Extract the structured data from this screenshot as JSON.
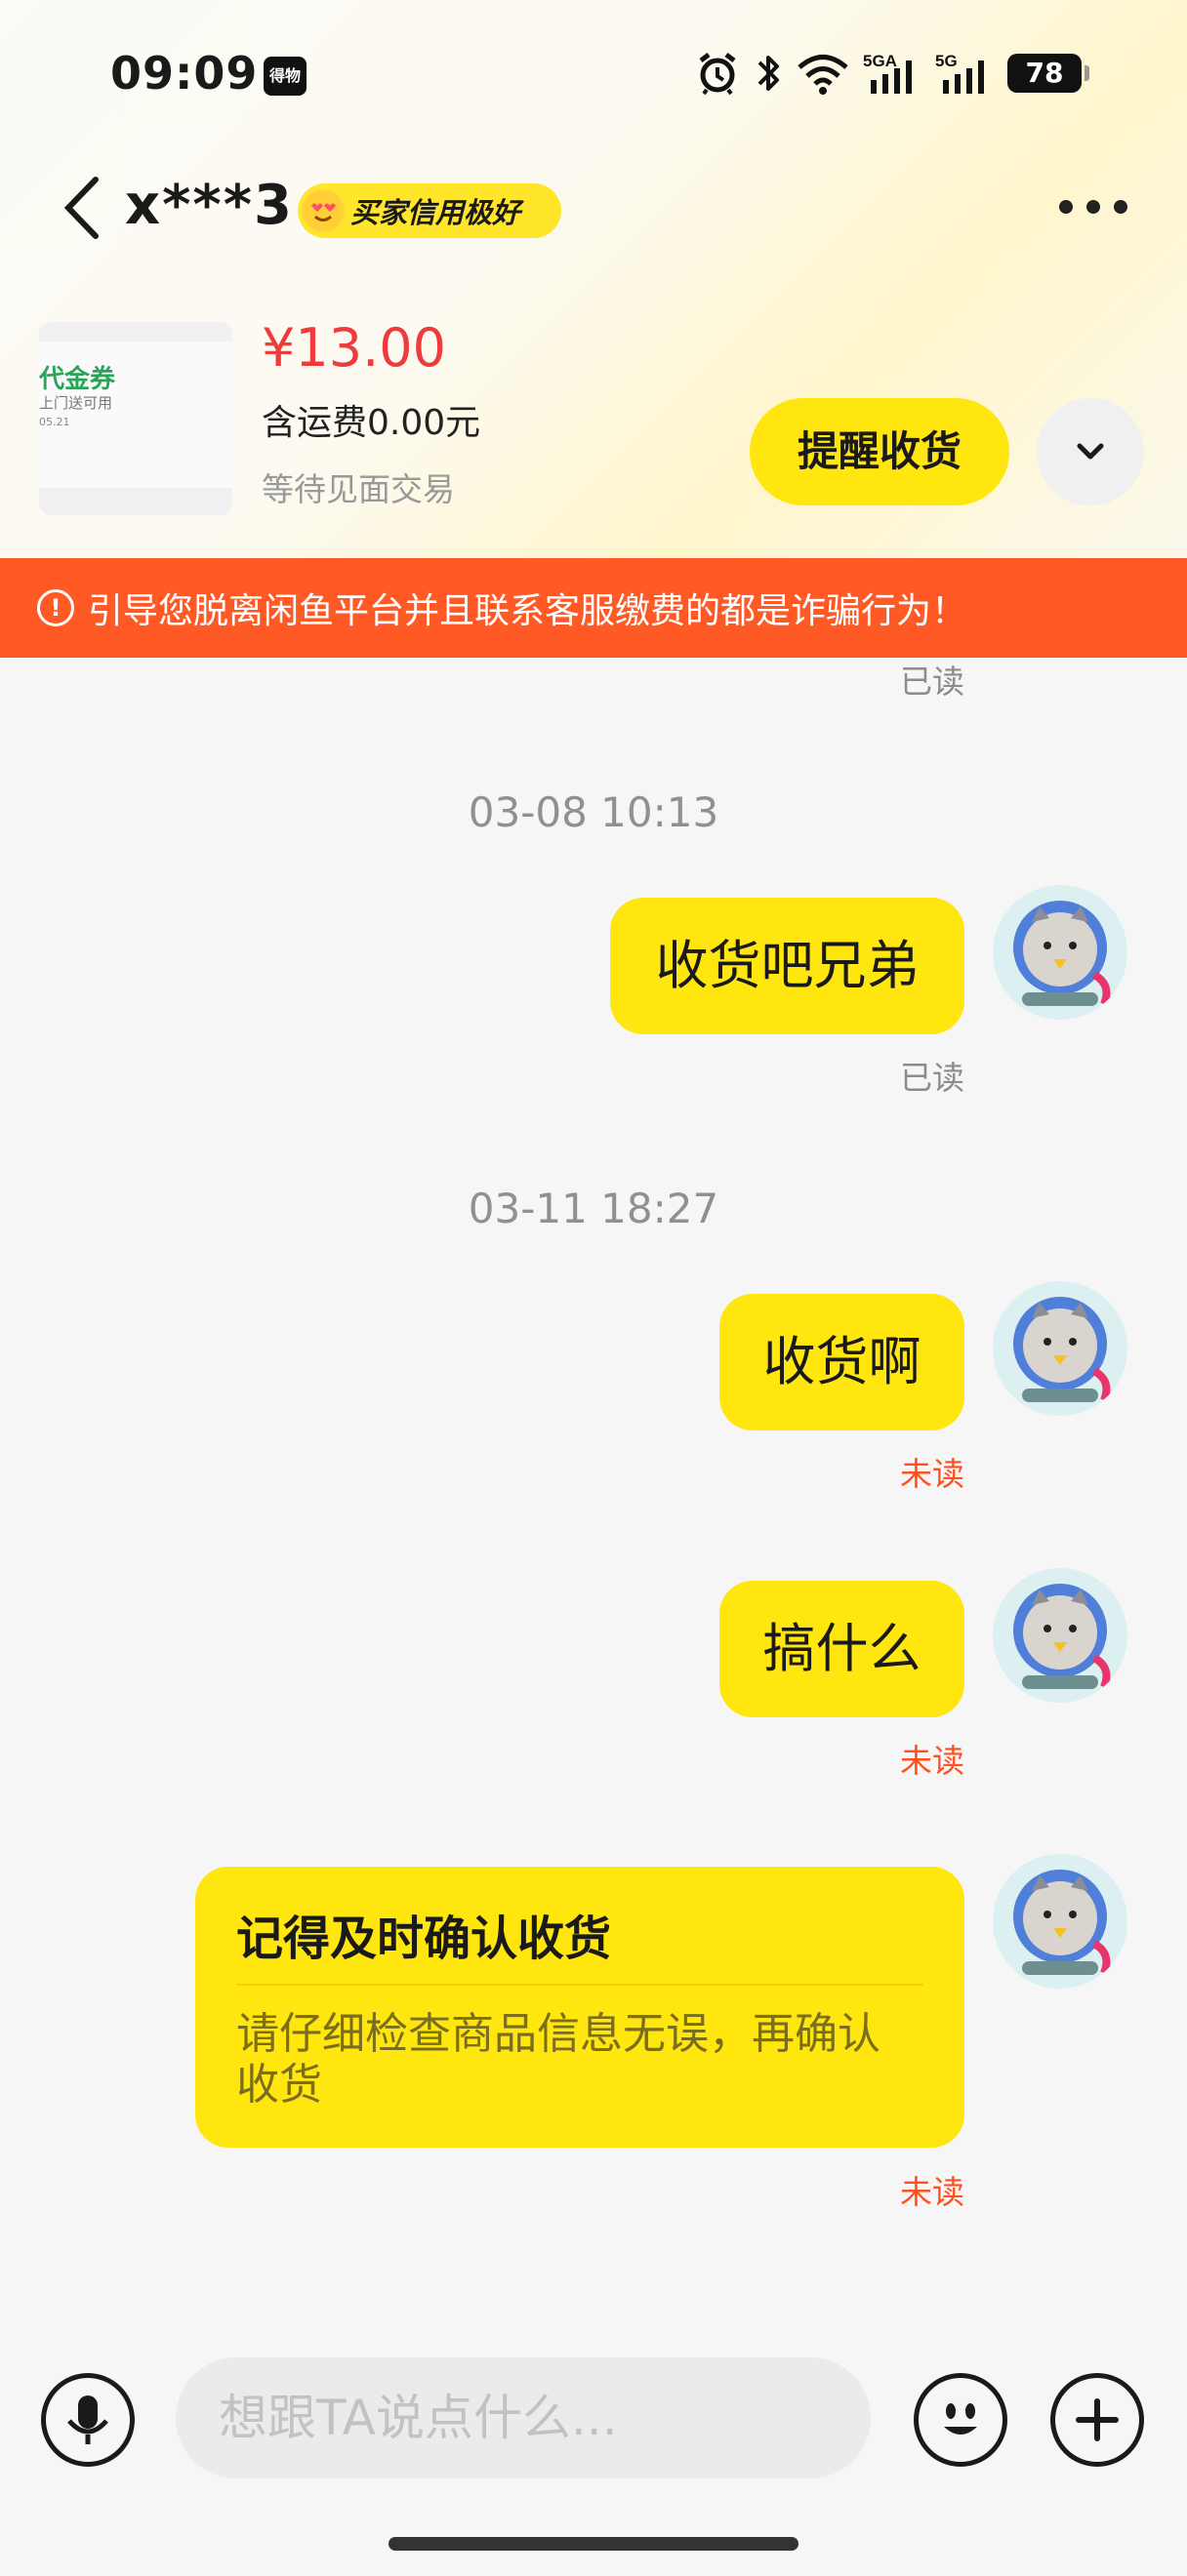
{
  "status_bar": {
    "time": "09:09",
    "notif_icon": "得物",
    "battery": "78",
    "icons": [
      "alarm-icon",
      "bluetooth-icon",
      "wifi-icon",
      "signal-5ga-icon",
      "signal-5g-icon"
    ]
  },
  "header": {
    "title": "x***3",
    "credit_badge": "买家信用极好",
    "more_icon": "more-icon"
  },
  "product": {
    "thumb_title": "代金券",
    "thumb_sub": "上门送可用",
    "thumb_date": "05.21",
    "price": "¥13.00",
    "shipping": "含运费0.00元",
    "state": "等待见面交易",
    "remind_button": "提醒收货"
  },
  "warning": {
    "text": "引导您脱离闲鱼平台并且联系客服缴费的都是诈骗行为！"
  },
  "chat": {
    "top_read": "已读",
    "timestamp1": "03-08 10:13",
    "msg1": "收货吧兄弟",
    "msg1_status": "已读",
    "timestamp2": "03-11 18:27",
    "msg2": "收货啊",
    "msg2_status": "未读",
    "msg3": "搞什么",
    "msg3_status": "未读",
    "card_title": "记得及时确认收货",
    "card_body": "请仔细检查商品信息无误，再确认收货",
    "card_status": "未读"
  },
  "input_bar": {
    "placeholder": "想跟TA说点什么..."
  },
  "colors": {
    "accent_yellow": "#ffe60f",
    "warning_orange": "#ff5a26",
    "price_red": "#ee3b3b",
    "unread_orange": "#ff5020"
  }
}
